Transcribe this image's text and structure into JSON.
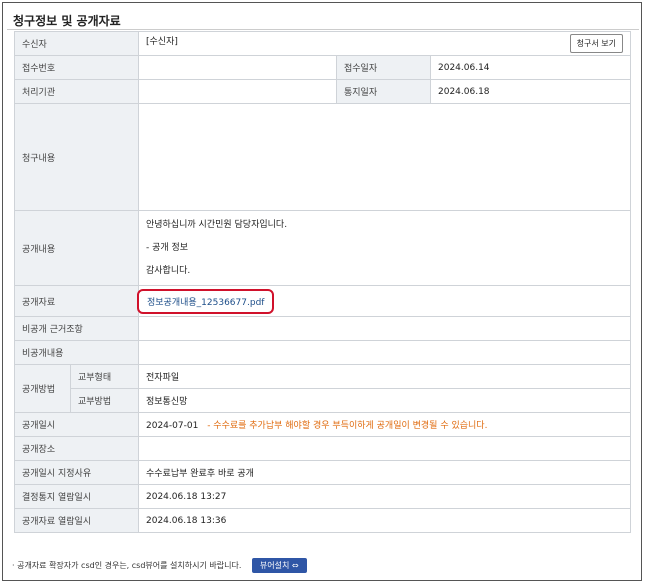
{
  "title": "청구정보 및 공개자료",
  "rows": {
    "recipient_label": "수신자",
    "recipient_value": "[수신자]",
    "view_claim_button": "청구서 보기",
    "receipt_no_label": "접수번호",
    "receipt_date_label": "접수일자",
    "receipt_date_value": "2024.06.14",
    "agency_label": "처리기관",
    "notice_date_label": "통지일자",
    "notice_date_value": "2024.06.18",
    "claim_content_label": "청구내용",
    "disclosure_content_label": "공개내용",
    "disclosure_line1": "안녕하십니까 시간민원 담당자입니다.",
    "disclosure_line2": "- 공개 정보",
    "disclosure_line3": "감사합니다.",
    "disclosure_file_label": "공개자료",
    "disclosure_file_name": "정보공개내용_12536677.pdf",
    "nondisclosure_basis_label": "비공개 근거조항",
    "nondisclosure_content_label": "비공개내용",
    "method_label": "공개방법",
    "delivery_form_label": "교부형태",
    "delivery_form_value": "전자파일",
    "delivery_method_label": "교부방법",
    "delivery_method_value": "정보통신망",
    "disclosure_date_label": "공개일시",
    "disclosure_date_value": "2024-07-01",
    "disclosure_date_warning": "- 수수료를 추가납부 해야할 경우 부득이하게 공개일이 변경될 수 있습니다.",
    "disclosure_place_label": "공개장소",
    "designation_reason_label": "공개일시 지정사유",
    "designation_reason_value": "수수료납부 완료후 바로 공개",
    "decision_viewed_label": "결정통지 열람일시",
    "decision_viewed_value": "2024.06.18 13:27",
    "file_viewed_label": "공개자료 열람일시",
    "file_viewed_value": "2024.06.18 13:36"
  },
  "footer": {
    "note": "· 공개자료 확장자가 csd인 경우는, csd뷰어를 설치하시기 바랍니다.",
    "install_button": "뷰어설치 ⇔"
  }
}
